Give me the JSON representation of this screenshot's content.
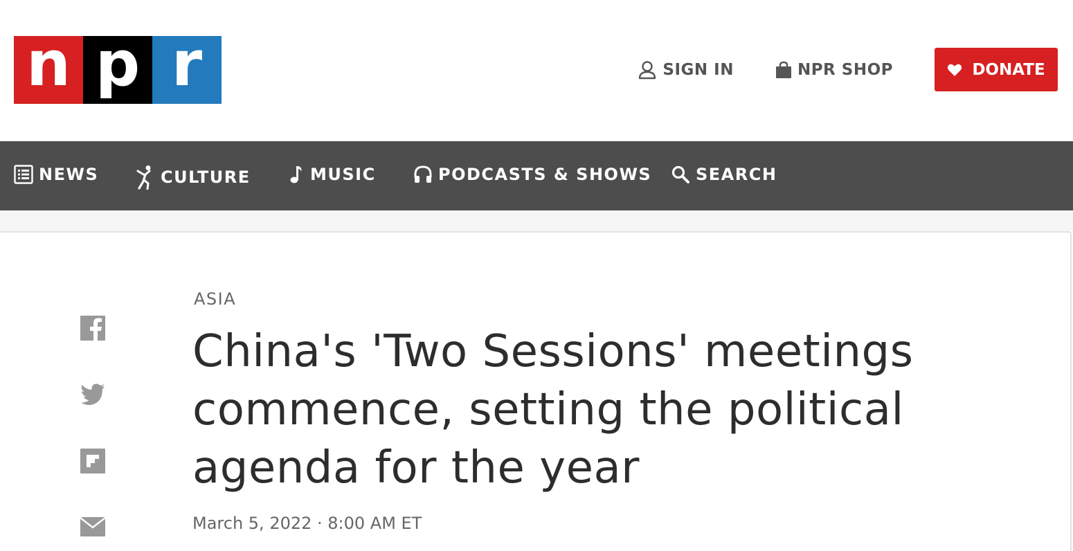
{
  "brand": {
    "letters": [
      "n",
      "p",
      "r"
    ],
    "colors": [
      "#d62021",
      "#000000",
      "#237bbd"
    ]
  },
  "header": {
    "sign_in": "SIGN IN",
    "shop": "NPR SHOP",
    "donate": "DONATE",
    "donate_color": "#d62021"
  },
  "nav": {
    "items": [
      {
        "label": "NEWS",
        "icon": "news-list-icon"
      },
      {
        "label": "CULTURE",
        "icon": "dancer-icon"
      },
      {
        "label": "MUSIC",
        "icon": "music-note-icon"
      },
      {
        "label": "PODCASTS & SHOWS",
        "icon": "headphones-icon"
      },
      {
        "label": "SEARCH",
        "icon": "search-icon"
      }
    ]
  },
  "share": [
    "facebook-icon",
    "twitter-icon",
    "flipboard-icon",
    "email-icon"
  ],
  "article": {
    "slug": "ASIA",
    "headline": "China's 'Two Sessions' meetings commence, setting the political agenda for the year",
    "date": "March 5, 2022 · 8:00 AM ET"
  }
}
